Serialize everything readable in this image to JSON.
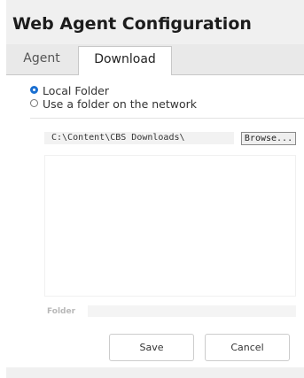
{
  "window": {
    "title": "Web Agent Configuration"
  },
  "tabs": [
    {
      "label": "Agent",
      "active": false
    },
    {
      "label": "Download",
      "active": true
    }
  ],
  "download": {
    "location_options": [
      {
        "label": "Local Folder",
        "selected": true
      },
      {
        "label": "Use a folder on the network",
        "selected": false
      }
    ],
    "path_value": "C:\\Content\\CBS Downloads\\",
    "browse_label": "Browse...",
    "folder_label": "Folder",
    "folder_value": ""
  },
  "actions": {
    "save_label": "Save",
    "cancel_label": "Cancel"
  },
  "colors": {
    "accent": "#1a6fd1",
    "window_bg": "#f0f0f0",
    "panel_bg": "#ffffff"
  }
}
